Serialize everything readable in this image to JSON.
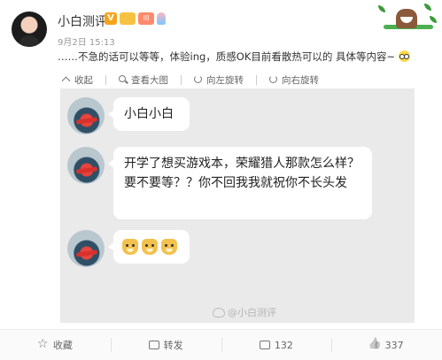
{
  "post": {
    "username": "小白测评",
    "badge_v": "V",
    "badge_level": "lll",
    "time": "9月2日 15:13",
    "text": "……不急的话可以等等，体验ing，质感OK目前看散热可以的 具体等内容~"
  },
  "toolbar": {
    "collapse_label": "收起",
    "view_large_label": "查看大图",
    "rotate_left_label": "向左旋转",
    "rotate_right_label": "向右旋转"
  },
  "chat": {
    "messages": [
      {
        "text": "小白小白"
      },
      {
        "text": "开学了想买游戏本，荣耀猎人那款怎么样？要不要等？？你不回我我就祝你不长头发"
      },
      {
        "emoji": "doge",
        "count": 3
      }
    ],
    "watermark": "@小白测评"
  },
  "footer": {
    "favorite_label": "收藏",
    "repost_label": "转发",
    "comment_count": "132",
    "like_count": "337"
  },
  "colors": {
    "image_bg": "#eaeaea",
    "bubble_bg": "#ffffff",
    "badge_v": "#f7a31a"
  },
  "icons": [
    "collapse-icon",
    "zoom-icon",
    "rotate-left-icon",
    "rotate-right-icon",
    "star-icon",
    "repost-icon",
    "comment-icon",
    "like-icon"
  ]
}
